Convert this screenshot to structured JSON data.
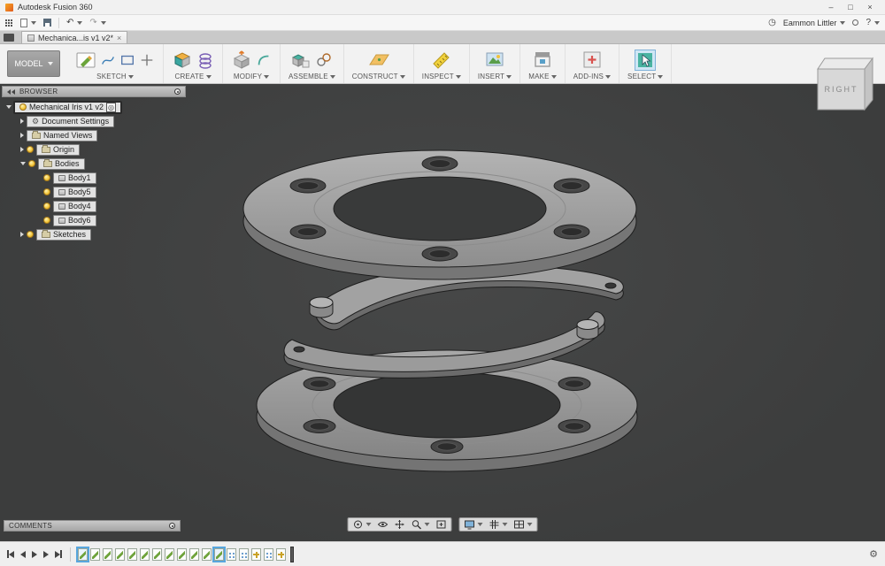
{
  "titlebar": {
    "title": "Autodesk Fusion 360"
  },
  "qat": {
    "user": "Eammon Littler"
  },
  "tab": {
    "label": "Mechanica...is v1 v2*"
  },
  "ribbon": {
    "mode": "MODEL",
    "groups": [
      "SKETCH",
      "CREATE",
      "MODIFY",
      "ASSEMBLE",
      "CONSTRUCT",
      "INSPECT",
      "INSERT",
      "MAKE",
      "ADD-INS",
      "SELECT"
    ]
  },
  "viewcube": {
    "face": "RIGHT"
  },
  "browser": {
    "header": "BROWSER",
    "root": "Mechanical Iris v1 v2",
    "items": [
      {
        "label": "Document Settings"
      },
      {
        "label": "Named Views"
      },
      {
        "label": "Origin"
      },
      {
        "label": "Bodies"
      },
      {
        "label": "Body1"
      },
      {
        "label": "Body5"
      },
      {
        "label": "Body4"
      },
      {
        "label": "Body6"
      },
      {
        "label": "Sketches"
      }
    ]
  },
  "comments": {
    "header": "COMMENTS"
  },
  "timeline": {
    "items": [
      {
        "type": "sketch",
        "selected": true
      },
      {
        "type": "sketch"
      },
      {
        "type": "sketch"
      },
      {
        "type": "sketch"
      },
      {
        "type": "sketch"
      },
      {
        "type": "sketch"
      },
      {
        "type": "sketch"
      },
      {
        "type": "sketch"
      },
      {
        "type": "sketch"
      },
      {
        "type": "sketch"
      },
      {
        "type": "sketch"
      },
      {
        "type": "sketch",
        "selected": true
      },
      {
        "type": "pattern"
      },
      {
        "type": "pattern"
      },
      {
        "type": "move"
      },
      {
        "type": "pattern"
      },
      {
        "type": "move"
      }
    ]
  },
  "icons": {
    "grid": "⊞",
    "undo": "↶",
    "redo": "↷",
    "clock": "◷",
    "help": "?",
    "gear": "⚙",
    "target": "◎",
    "min": "–",
    "max": "□",
    "close": "×",
    "tab_close": "×"
  },
  "colors": {
    "accent_blue": "#58a6dd",
    "canvas": "#3f4040",
    "model_gray": "#9e9e9e",
    "select_highlight": "#cfe6f5"
  }
}
